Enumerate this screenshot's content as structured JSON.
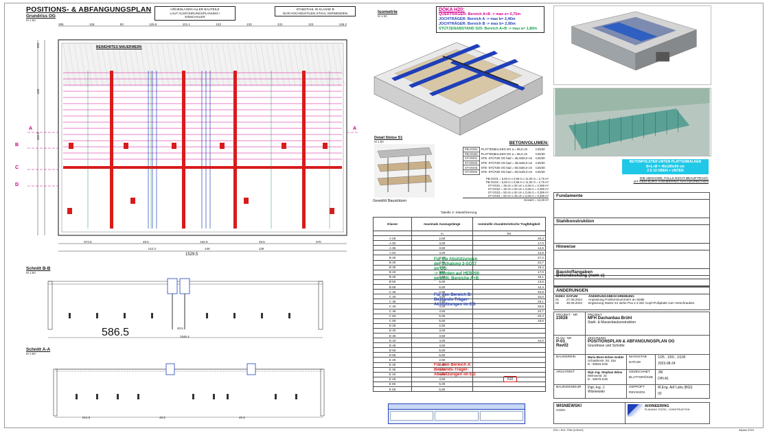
{
  "drawing": {
    "main_title": "POSITIONS- & ABFANGUNGSPLAN",
    "plan_label": "Grundriss OG",
    "plan_scale": "M 1:50",
    "note_heights": [
      "HÖHENLAGEN ALLER BAUTEILE",
      "LAUT AUSFÜHRUNGSPLANUNG !",
      "EINSCHALER"
    ],
    "note_steel": [
      "STABSTAHL IN KLASSE B",
      "NUR HOCHDUKTILEN STAHL VERWENDEN"
    ],
    "reinforced_masonry_title": "BEWEHRTES MAUERWERK",
    "top_dims": [
      "285",
      "126",
      "93",
      "125.5",
      "101.1",
      "133",
      "133",
      "131",
      "123",
      "136.2"
    ],
    "bottom_dims_1": [
      "674.5",
      "49.5",
      "432.9",
      "49.5",
      "670"
    ],
    "bottom_dims_2": [
      "142.3",
      "246",
      "128"
    ],
    "total_width": "1529.5",
    "left_dims": [
      "203",
      "426",
      "482.5"
    ],
    "axis_letters": [
      "A",
      "B",
      "C",
      "D",
      "A"
    ],
    "section_bb_title": "Schnitt B-B",
    "section_bb_scale": "M 1:50",
    "section_bb_dims": [
      "586.5",
      "40.5",
      "1546.4"
    ],
    "section_aa_title": "Schnitt A-A",
    "section_aa_scale": "M 1:50",
    "section_aa_dims": [
      "614.5",
      "40.5",
      "40.6"
    ],
    "isometry_label": "Isometrie",
    "isometry_scale": "M 1:50"
  },
  "doka": {
    "title": "DOKA H20:",
    "lines": [
      {
        "text": "QUERTRÄGER: Bereich A+B -> max e= 0,75m",
        "color": "#d6008f"
      },
      {
        "text": "JOCHTRÄGER: Bereich A -> max b= 2,46m",
        "color": "#1f3fb8"
      },
      {
        "text": "JOCHTRÄGER: Bereich B -> max b= 2,90m",
        "color": "#1f3fb8"
      },
      {
        "text": "STÜTZENABSTAND S25: Bereich A+B -> max a= 1,80m",
        "color": "#15a050"
      }
    ]
  },
  "detail": {
    "title": "Detail Stütze S1",
    "scale": "M 1:50",
    "caption": "Gewählt Baustützen"
  },
  "betonvolumen": {
    "title": "BETONVOLUMEN:",
    "rows": [
      [
        "PB-OG01",
        "PLATTENBALKEN OG a = 86,0 cm",
        "C25/30"
      ],
      [
        "PB-OG02",
        "PLATTENBALKEN OG a = 86,0 cm",
        "C25/30"
      ],
      [
        "ST-OG01",
        "STB -STÜTZE OG bad = 36,0x50,0 cm",
        "C25/30"
      ],
      [
        "ST-OG02",
        "STB -STÜTZE OG bad = 36,0x50,0 cm",
        "C25/30"
      ],
      [
        "ST-OG03",
        "STB -STÜTZE OG bad = 50,0x50,0 cm",
        "C25/30"
      ],
      [
        "ST-OG04",
        "STB -STÜTZE OG bad = 60,0x35,0 cm",
        "C25/30"
      ]
    ],
    "calc_rows": [
      "PB-OG01 = 5,50 m x 0,86 m x 11,00 m = 2,75 m³",
      "PB-OG02 = 5,50 m x 0,86 m x 11,00 m = 2,75 m³",
      "ST-OG01 = 36 cm x 50 cm x 2,66 m = 0,399 m³",
      "ST-OG02 = 36 cm x 50 cm x 2,66 m = 0,399 m³",
      "ST-OG03 = 50 cm x 50 cm x 2,66 m = 0,399 m³",
      "ST-OG04 = 60 cm x 35 cm x 2,66 m = 0,399 m³"
    ],
    "total": "Gesamt = 12,26 m³"
  },
  "klassen": {
    "caption": "Tabelle 2: Klassifizierung",
    "headers": [
      "Klasse",
      "maximale Auszugslänge",
      "nominelle charakteristische Tragfähigkeit",
      "kN"
    ],
    "units": [
      "",
      "m",
      "kN"
    ],
    "groups": [
      {
        "rows": [
          [
            "A 25",
            "2,50",
            "20,4"
          ],
          [
            "A 30",
            "3,00",
            "17,0"
          ],
          [
            "A 35",
            "3,50",
            "14,6"
          ],
          [
            "A 40",
            "4,00",
            "12,8"
          ]
        ]
      },
      {
        "rows": [
          [
            "B 25",
            "2,50",
            "27,2"
          ],
          [
            "B 30",
            "3,00",
            "22,7"
          ],
          [
            "B 35",
            "3,50",
            "19,4"
          ],
          [
            "B 40",
            "4,00",
            "17,0"
          ],
          [
            "B 45",
            "4,50",
            "15,1"
          ],
          [
            "B 50",
            "5,00",
            "13,6"
          ],
          [
            "B 55",
            "5,50",
            "12,4"
          ]
        ]
      },
      {
        "rows": [
          [
            "C 25",
            "2,50",
            "40,8"
          ],
          [
            "C 30",
            "3,00",
            "34,0"
          ],
          [
            "C 35",
            "3,50",
            "29,1"
          ],
          [
            "C 40",
            "4,00",
            "25,5"
          ],
          [
            "C 45",
            "4,50",
            "22,7"
          ],
          [
            "C 50",
            "5,00",
            "20,4"
          ],
          [
            "C 55",
            "5,50",
            "18,6"
          ]
        ]
      },
      {
        "rows": [
          [
            "D 25",
            "2,50",
            ""
          ],
          [
            "D 30",
            "3,00",
            ""
          ],
          [
            "D 35",
            "3,50",
            ""
          ],
          [
            "D 40",
            "4,00",
            "34,0"
          ],
          [
            "D 45",
            "4,50",
            ""
          ],
          [
            "D 50",
            "5,00",
            ""
          ],
          [
            "D 55",
            "5,50",
            ""
          ]
        ]
      },
      {
        "rows": [
          [
            "E 25",
            "2,50",
            ""
          ],
          [
            "E 30",
            "3,00",
            ""
          ],
          [
            "E 35",
            "3,50",
            ""
          ],
          [
            "E 40",
            "4,00",
            ""
          ],
          [
            "E 45",
            "4,50",
            ""
          ],
          [
            "E 50",
            "5,00",
            ""
          ],
          [
            "E 55",
            "5,50",
            ""
          ]
        ]
      }
    ],
    "comment_green": [
      "Für die Abstützungen",
      "der Schalung 3-SO27",
      "im OG",
      "-> Werden auf HEB200",
      "gestellt. Bereiche A+B"
    ],
    "comment_blue": [
      "Für den Bereich B:",
      "Bestands-Träger-",
      "Abstützungen im EG"
    ],
    "comment_red": [
      "Für den Bereich A:",
      "Bestands-Träger-",
      "Abstützungen im EG"
    ],
    "red_value": "510"
  },
  "right_notes": {
    "cyan_note": [
      "BETONPOLSTER UNTER PLATTENBALKEN",
      "B=L+Ø = 45x180x50 cm",
      "2 E 10 OBEN + UNTEN"
    ],
    "acceptance": [
      "DIE ABNAHME, FALLS NICHT BEAUFTRAGT,",
      "IST DEM BÜRO AIXINEERING NACHZUREICHEN"
    ]
  },
  "sections": {
    "fundamente": "Fundamente",
    "stahlkonstruktion": "Stahlkonstruktion",
    "hinweise": "Hinweise",
    "baustoffangaben": "Baustoffangaben",
    "betondeckung": "Betondeckung (nom c)",
    "aenderungen": "ÄNDERUNGEN",
    "aend_headers": [
      "INDEX",
      "DATUM",
      "ÄNDERUNGSBESCHREIBUNG"
    ],
    "aend_rows": [
      [
        "01",
        "27.08.2024",
        "Anpassung Positionsnummern an Statik"
      ],
      [
        "02",
        "30.08.2024",
        "Ergänzung Stütze S1 siehe Pos 2.3 inkl. Kopf-/Fußplatte zum Verschrauben"
      ]
    ]
  },
  "titleblock": {
    "projekt_nr_label": "PROJEKT - NR",
    "projekt_nr": "23028",
    "projekt_label": "PROJEKT",
    "projekt": "MFH Dachanbau Brühl",
    "projekt_sub": "Stahl- & Massivbaukonstruktion",
    "plan_nr_label": "PLAN - NR",
    "plan_nr": "P-03_",
    "plan_rev": "Rev02",
    "zeichnung_label": "ZEICHNUNG",
    "zeichnung": "POSITIONSPLAN & ABFANGUNGSPLAN OG",
    "zeichnung_sub": "Grundrisse und Schnitte",
    "bauherrin_label": "BAUHERRIN",
    "bauherrin": [
      "Maria Bonn Erben GmbH",
      "Schaafenstr. Str. 15a",
      "D - 50933 Köln"
    ],
    "architekt_label": "ARCHITEKT",
    "architekt": [
      "Dipl.-Ing. Stephan Wims",
      "Melrosestr. 24",
      "D - 50678 Köln"
    ],
    "bauingenieur_label": "BAUINGENIEUR",
    "bauingenieur": [
      "Dipl.-Ing. J.",
      "Wisniewski"
    ],
    "massstab_label": "MASSSTAB",
    "massstab": "1/25 , 1/50 , 1/100",
    "datum_label": "DATUM",
    "datum": "2023-08-24",
    "gezeichnet_label": "GEZEICHNET",
    "gezeichnet": "JW",
    "blattgroesse_label": "BLATTGRÖSSE",
    "blattgroesse": "DIN A1",
    "geprueft_label": "GEPRÜFT",
    "geprueft": "M.Eng. Arif Lahu (BGI)",
    "revision_label": "REVISION",
    "revision": "02",
    "company_left": "WISNIEWSKI",
    "company_left_sub": "GmbH",
    "company_right": "AIXINEERING",
    "company_right_sub": "PLANUNG STATIK - KONSTRUKTION",
    "footer_left": "E01 • E01.TSM (0.50m²)",
    "footer_right": "Allplan 2024"
  },
  "colors": {
    "magenta": "#d6008f",
    "red": "#d81b1b",
    "blue": "#1f3fb8",
    "green": "#15a050",
    "cyan": "#1ec8e6"
  }
}
